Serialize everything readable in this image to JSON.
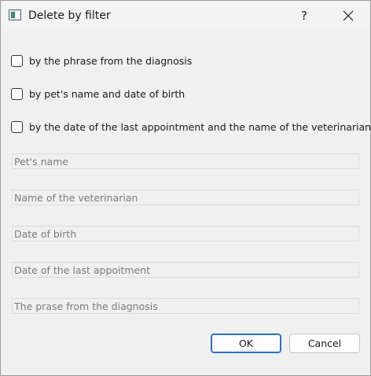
{
  "window": {
    "title": "Delete by filter",
    "help_label": "?",
    "close_icon": "close-icon"
  },
  "filters": [
    {
      "label": "by the phrase from the diagnosis",
      "checked": false
    },
    {
      "label": "by pet's name and date of birth",
      "checked": false
    },
    {
      "label": "by the date of the last appointment and the name of the veterinarian",
      "checked": false
    }
  ],
  "fields": [
    {
      "placeholder": "Pet's name",
      "value": ""
    },
    {
      "placeholder": "Name of the veterinarian",
      "value": ""
    },
    {
      "placeholder": "Date of birth",
      "value": ""
    },
    {
      "placeholder": "Date of the last appoitment",
      "value": ""
    },
    {
      "placeholder": "The prase from the diagnosis",
      "value": ""
    }
  ],
  "buttons": {
    "ok": "OK",
    "cancel": "Cancel"
  },
  "colors": {
    "accent": "#2a6fc4",
    "background": "#f0f0f0"
  }
}
